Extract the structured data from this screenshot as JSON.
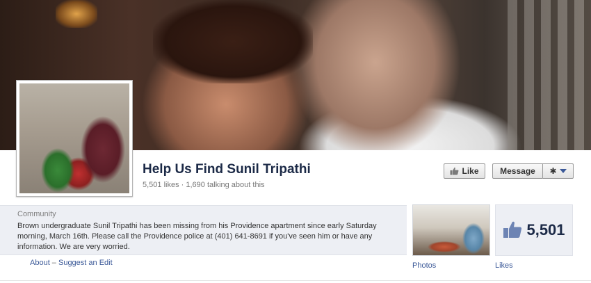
{
  "page": {
    "name": "Help Us Find Sunil Tripathi",
    "likes": "5,501 likes",
    "stats_separator": " · ",
    "talking": "1,690 talking about this"
  },
  "actions": {
    "like_label": "Like",
    "message_label": "Message"
  },
  "about": {
    "category": "Community",
    "description": "Brown undergraduate Sunil Tripathi has been missing from his Providence apartment since early Saturday morning, March 16th. Please call the Providence police at (401) 641-8691 if you've seen him or have any information. We are very worried.",
    "links": {
      "about": "About",
      "separator": " – ",
      "suggest_edit": "Suggest an Edit"
    }
  },
  "apps": {
    "photos_label": "Photos",
    "likes_label": "Likes",
    "likes_count": "5,501"
  },
  "icons": {
    "like": "thumbs-up-icon",
    "gear": "gear-icon",
    "dropdown": "chevron-down-icon"
  },
  "colors": {
    "link": "#3b5998",
    "title": "#1c2a47",
    "panel": "#edeff4"
  }
}
